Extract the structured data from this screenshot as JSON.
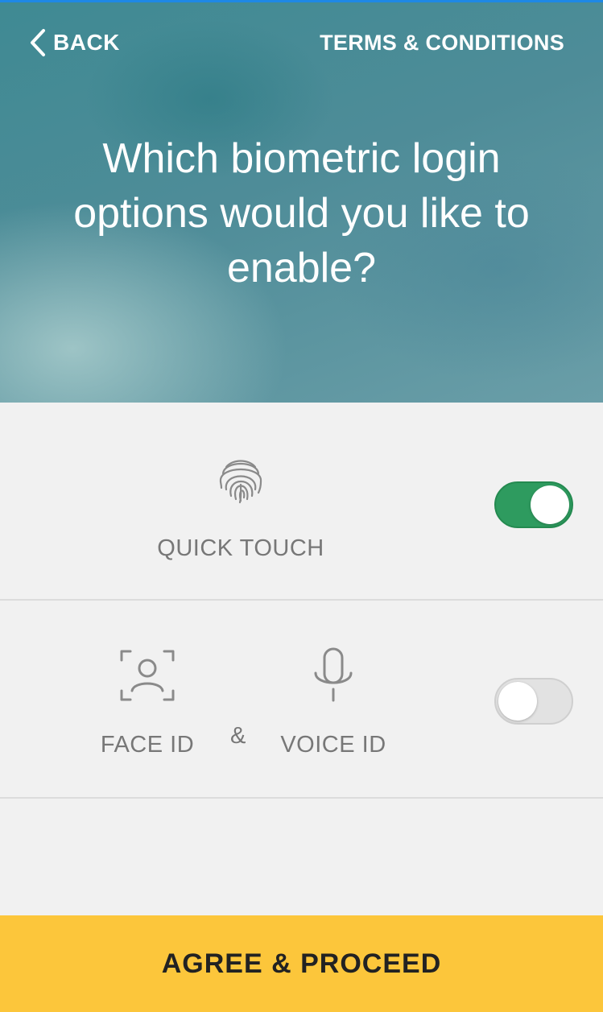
{
  "nav": {
    "back_label": "BACK",
    "terms_label": "TERMS & CONDITIONS"
  },
  "headline": "Which biometric login options would you like to enable?",
  "options": {
    "quick_touch": {
      "label": "QUICK TOUCH",
      "icon": "fingerprint-icon",
      "enabled": true
    },
    "face_voice": {
      "face_label": "FACE ID",
      "face_icon": "face-scan-icon",
      "separator": "&",
      "voice_label": "VOICE ID",
      "voice_icon": "microphone-icon",
      "enabled": false
    }
  },
  "cta_label": "AGREE & PROCEED",
  "colors": {
    "toggle_on": "#2e9b5f",
    "cta_background": "#fcc63b",
    "header_teal": "#4e8c98"
  }
}
